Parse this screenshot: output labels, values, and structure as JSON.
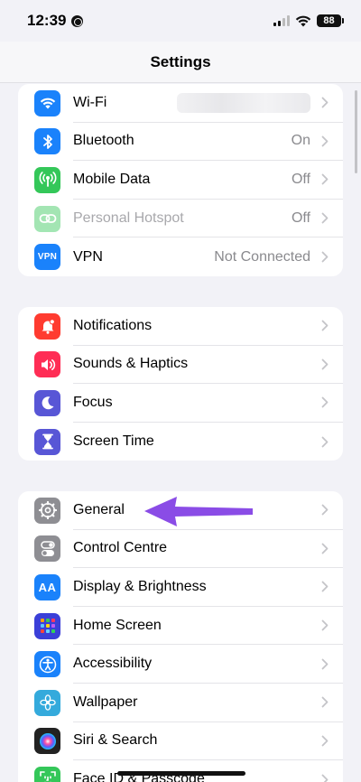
{
  "status_bar": {
    "time": "12:39",
    "battery": "88"
  },
  "nav": {
    "title": "Settings"
  },
  "connectivity": [
    {
      "label": "Wi-Fi",
      "value": "",
      "icon": "wifi-icon",
      "color": "#1a82fb"
    },
    {
      "label": "Bluetooth",
      "value": "On",
      "icon": "bluetooth-icon",
      "color": "#1a82fb"
    },
    {
      "label": "Mobile Data",
      "value": "Off",
      "icon": "antenna-icon",
      "color": "#34c759"
    },
    {
      "label": "Personal Hotspot",
      "value": "Off",
      "icon": "hotspot-link-icon",
      "color": "#34c759"
    },
    {
      "label": "VPN",
      "value": "Not Connected",
      "icon": "vpn-icon",
      "icon_text": "VPN",
      "color": "#1a82fb"
    }
  ],
  "notifications_group": [
    {
      "label": "Notifications",
      "icon": "bell-icon",
      "color": "#ff3b30"
    },
    {
      "label": "Sounds & Haptics",
      "icon": "speaker-icon",
      "color": "#ff2d55"
    },
    {
      "label": "Focus",
      "icon": "moon-icon",
      "color": "#5856d6"
    },
    {
      "label": "Screen Time",
      "icon": "hourglass-icon",
      "color": "#5856d6"
    }
  ],
  "general_group": [
    {
      "label": "General",
      "icon": "gear-icon",
      "color": "#8e8e93"
    },
    {
      "label": "Control Centre",
      "icon": "toggles-icon",
      "color": "#8e8e93"
    },
    {
      "label": "Display & Brightness",
      "icon": "text-size-icon",
      "icon_text": "AA",
      "color": "#1a82fb"
    },
    {
      "label": "Home Screen",
      "icon": "app-grid-icon",
      "color": "#3b3fd8"
    },
    {
      "label": "Accessibility",
      "icon": "accessibility-icon",
      "color": "#1a82fb"
    },
    {
      "label": "Wallpaper",
      "icon": "flower-icon",
      "color": "#34aadc"
    },
    {
      "label": "Siri & Search",
      "icon": "siri-icon",
      "color": "#222222"
    },
    {
      "label": "Face ID & Passcode",
      "icon": "face-id-icon",
      "color": "#34c759"
    }
  ],
  "annotation": {
    "arrow_color": "#8a4ce6"
  }
}
